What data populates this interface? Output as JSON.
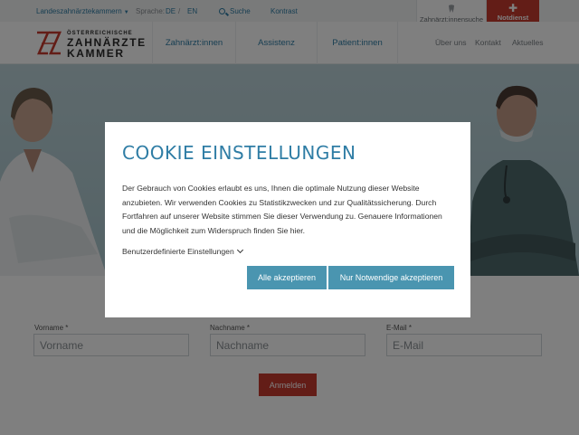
{
  "topbar": {
    "landeskammern": "Landeszahnärztekammern",
    "language_label": "Sprache:",
    "lang_de": "DE",
    "lang_sep": "/",
    "lang_en": "EN",
    "search": "Suche",
    "contrast": "Kontrast",
    "dentist_search": "Zahnärzt:innensuche",
    "emergency": "Notdienst"
  },
  "logo": {
    "line_small": "ÖSTERREICHISCHE",
    "line1": "ZAHNÄRZTE",
    "line2": "KAMMER"
  },
  "nav": {
    "main": [
      "Zahnärzt:innen",
      "Assistenz",
      "Patient:innen"
    ],
    "secondary": [
      "Über uns",
      "Kontakt",
      "Aktuelles"
    ]
  },
  "form": {
    "fields": [
      {
        "label": "Vorname *",
        "placeholder": "Vorname"
      },
      {
        "label": "Nachname *",
        "placeholder": "Nachname"
      },
      {
        "label": "E-Mail *",
        "placeholder": "E-Mail"
      }
    ],
    "submit": "Anmelden"
  },
  "cookie": {
    "title": "COOKIE EINSTELLUNGEN",
    "text": "Der Gebrauch von Cookies erlaubt es uns, Ihnen die optimale Nutzung dieser Website anzubieten. Wir verwenden Cookies zu Statistikzwecken und zur Qualitätssicherung. Durch Fortfahren auf unserer Website stimmen Sie dieser Verwendung zu. Genauere Informationen und die Möglichkeit zum Widerspruch finden Sie hier.",
    "custom_settings": "Benutzerdefinierte Einstellungen",
    "accept_all": "Alle akzeptieren",
    "accept_necessary": "Nur Notwendige akzeptieren"
  },
  "colors": {
    "accent": "#2f7da5",
    "brand_red": "#c63a2f",
    "button_teal": "#4a95b0"
  },
  "icons": {
    "tooth": "tooth-icon",
    "emergency": "plus-icon",
    "search": "search-icon",
    "chevron": "chevron-down-icon"
  }
}
